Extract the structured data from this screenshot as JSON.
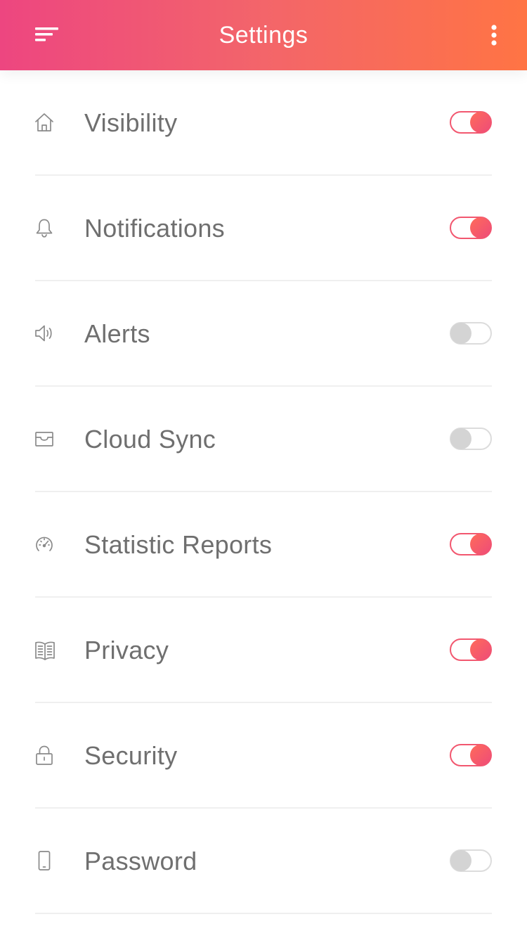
{
  "header": {
    "title": "Settings",
    "menu_icon": "menu-icon",
    "more_icon": "more-vertical-icon",
    "gradient": [
      "#ED4680",
      "#FF7444"
    ]
  },
  "settings": [
    {
      "id": "visibility",
      "label": "Visibility",
      "icon": "home-icon",
      "enabled": true
    },
    {
      "id": "notifications",
      "label": "Notifications",
      "icon": "bell-icon",
      "enabled": true
    },
    {
      "id": "alerts",
      "label": "Alerts",
      "icon": "speaker-icon",
      "enabled": false
    },
    {
      "id": "cloud-sync",
      "label": "Cloud Sync",
      "icon": "inbox-icon",
      "enabled": false
    },
    {
      "id": "statistic-reports",
      "label": "Statistic Reports",
      "icon": "speedometer-icon",
      "enabled": true
    },
    {
      "id": "privacy",
      "label": "Privacy",
      "icon": "book-icon",
      "enabled": true
    },
    {
      "id": "security",
      "label": "Security",
      "icon": "lock-icon",
      "enabled": true
    },
    {
      "id": "password",
      "label": "Password",
      "icon": "phone-icon",
      "enabled": false
    }
  ],
  "colors": {
    "toggle_on": "#F2576F",
    "toggle_off": "#D4D4D4",
    "label": "#6F6F6F",
    "icon": "#8A8A8A"
  }
}
